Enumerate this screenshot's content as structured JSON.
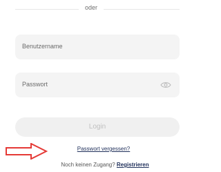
{
  "divider": {
    "text": "oder"
  },
  "form": {
    "username_placeholder": "Benutzername",
    "password_placeholder": "Passwort",
    "password_toggle_icon": "eye-icon",
    "login_label": "Login"
  },
  "links": {
    "forgot_password": "Passwort vergessen?",
    "no_account_text": "Noch keinen Zugang?",
    "register_label": "Registrieren"
  },
  "annotation": {
    "arrow_icon": "arrow-right-icon",
    "arrow_color": "#e53935"
  },
  "colors": {
    "link": "#1f2f5a",
    "field_bg": "#f4f4f4",
    "button_bg": "#f0f0f0"
  }
}
